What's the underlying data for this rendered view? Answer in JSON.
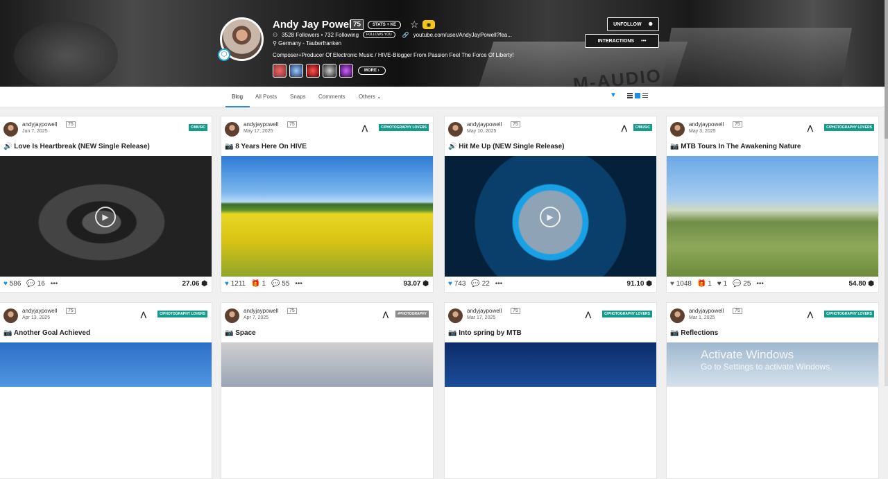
{
  "profile": {
    "name": "Andy Jay Powell",
    "reputation": "75",
    "stats_button": "STATS + KE",
    "followers_following": "3528 Followers • 732 Following",
    "follows_you": "FOLLOWS YOU",
    "website": "youtube.com/user/AndyJayPowell?fea...",
    "location": "Germany - Tauberfranken",
    "bio": "Composer+Producer Of Electronic Music / HIVE-Blogger From Passion Feel The Force Of Liberty!",
    "more_label": "MORE",
    "unfollow_label": "UNFOLLOW",
    "interactions_label": "INTERACTIONS",
    "interactions_more": "•••",
    "banner_text": "M-AUDIO"
  },
  "tabs": [
    "Blog",
    "All Posts",
    "Snaps",
    "Comments",
    "Others"
  ],
  "posts": [
    {
      "author": "andyjaypowell",
      "rep": "75",
      "date": "Jun 7, 2025",
      "community": "C/MUSIC",
      "title": "🔊 Love Is Heartbreak (NEW Single Release)",
      "likes": "586",
      "comments": "16",
      "payout": "27.06"
    },
    {
      "author": "andyjaypowell",
      "rep": "75",
      "date": "May 17, 2025",
      "community": "C/PHOTOGRAPHY LOVERS",
      "title": "📷 8 Years Here On HIVE",
      "likes": "1211",
      "gifts": "1",
      "comments": "55",
      "payout": "93.07"
    },
    {
      "author": "andyjaypowell",
      "rep": "75",
      "date": "May 10, 2025",
      "community": "C/MUSIC",
      "title": "🔊 Hit Me Up (NEW Single Release)",
      "likes": "743",
      "comments": "22",
      "payout": "91.10"
    },
    {
      "author": "andyjaypowell",
      "rep": "75",
      "date": "May 3, 2025",
      "community": "C/PHOTOGRAPHY LOVERS",
      "title": "📷 MTB Tours In The Awakening Nature",
      "likes": "1048",
      "gifts": "1",
      "reblogs": "1",
      "comments": "25",
      "payout": "54.80"
    },
    {
      "author": "andyjaypowell",
      "rep": "75",
      "date": "Apr 13, 2025",
      "community": "C/PHOTOGRAPHY LOVERS",
      "title": "📷 Another Goal Achieved"
    },
    {
      "author": "andyjaypowell",
      "rep": "75",
      "date": "Apr 7, 2025",
      "community": "#PHOTOGRAPHY",
      "title": "📷 Space"
    },
    {
      "author": "andyjaypowell",
      "rep": "75",
      "date": "Mar 17, 2025",
      "community": "C/PHOTOGRAPHY LOVERS",
      "title": "📷 Into spring by MTB"
    },
    {
      "author": "andyjaypowell",
      "rep": "75",
      "date": "Mar 1, 2025",
      "community": "C/PHOTOGRAPHY LOVERS",
      "title": "📷 Reflections"
    }
  ],
  "overlay": {
    "line1": "Activate Windows",
    "line2": "Go to Settings to activate Windows."
  }
}
